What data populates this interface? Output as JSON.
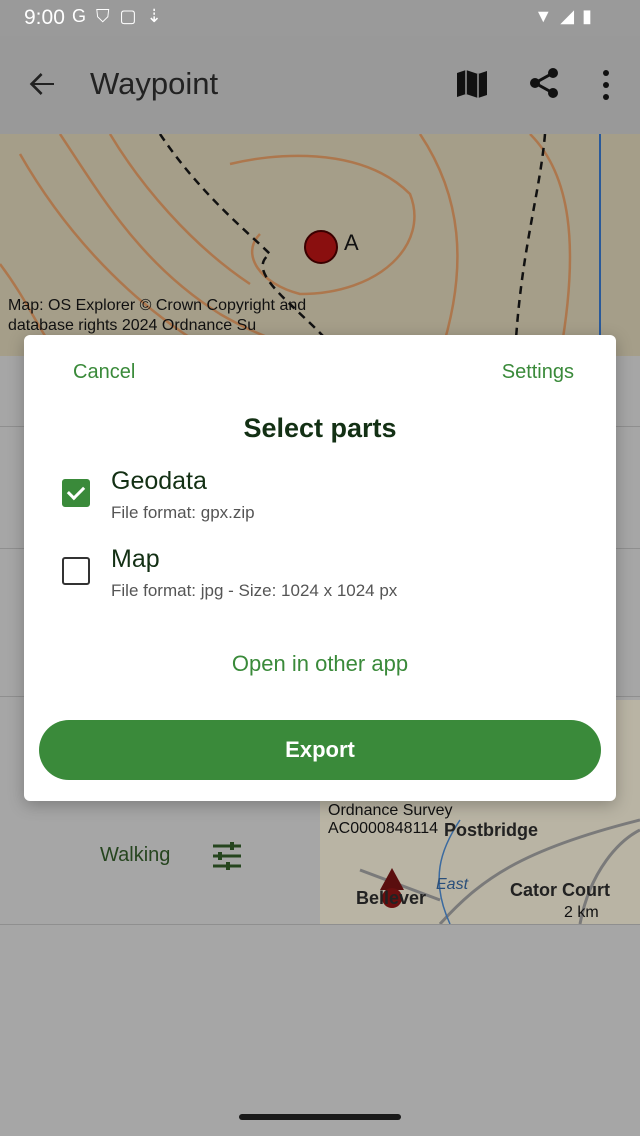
{
  "status_bar": {
    "time": "9:00",
    "left_icons": [
      "google-icon",
      "shield-icon",
      "cast-icon",
      "download-icon"
    ],
    "right_icons": [
      "wifi-icon",
      "signal-icon",
      "battery-icon"
    ]
  },
  "app_bar": {
    "title": "Waypoint",
    "actions": [
      "map-icon",
      "share-icon",
      "more-vert-icon"
    ]
  },
  "map_top": {
    "credit": "Map: OS Explorer © Crown Copyright and database rights 2024 Ordnance Su",
    "marker_label": "A"
  },
  "behind": {
    "walking_label": "Walking",
    "map_credit": "Ordnance Survey AC0000848114",
    "places": [
      "Postbridge",
      "Cator Court",
      "Bellever",
      "East"
    ],
    "scale_label": "2 km"
  },
  "dialog": {
    "cancel_label": "Cancel",
    "settings_label": "Settings",
    "title": "Select parts",
    "options": [
      {
        "title": "Geodata",
        "subtitle": "File format: gpx.zip",
        "checked": true
      },
      {
        "title": "Map",
        "subtitle": "File format: jpg - Size: 1024 x 1024 px",
        "checked": false
      }
    ],
    "open_other_label": "Open in other app",
    "export_label": "Export"
  },
  "colors": {
    "accent": "#3a8a3a",
    "title_text": "#133014",
    "scrim": "#a6a6a6"
  }
}
